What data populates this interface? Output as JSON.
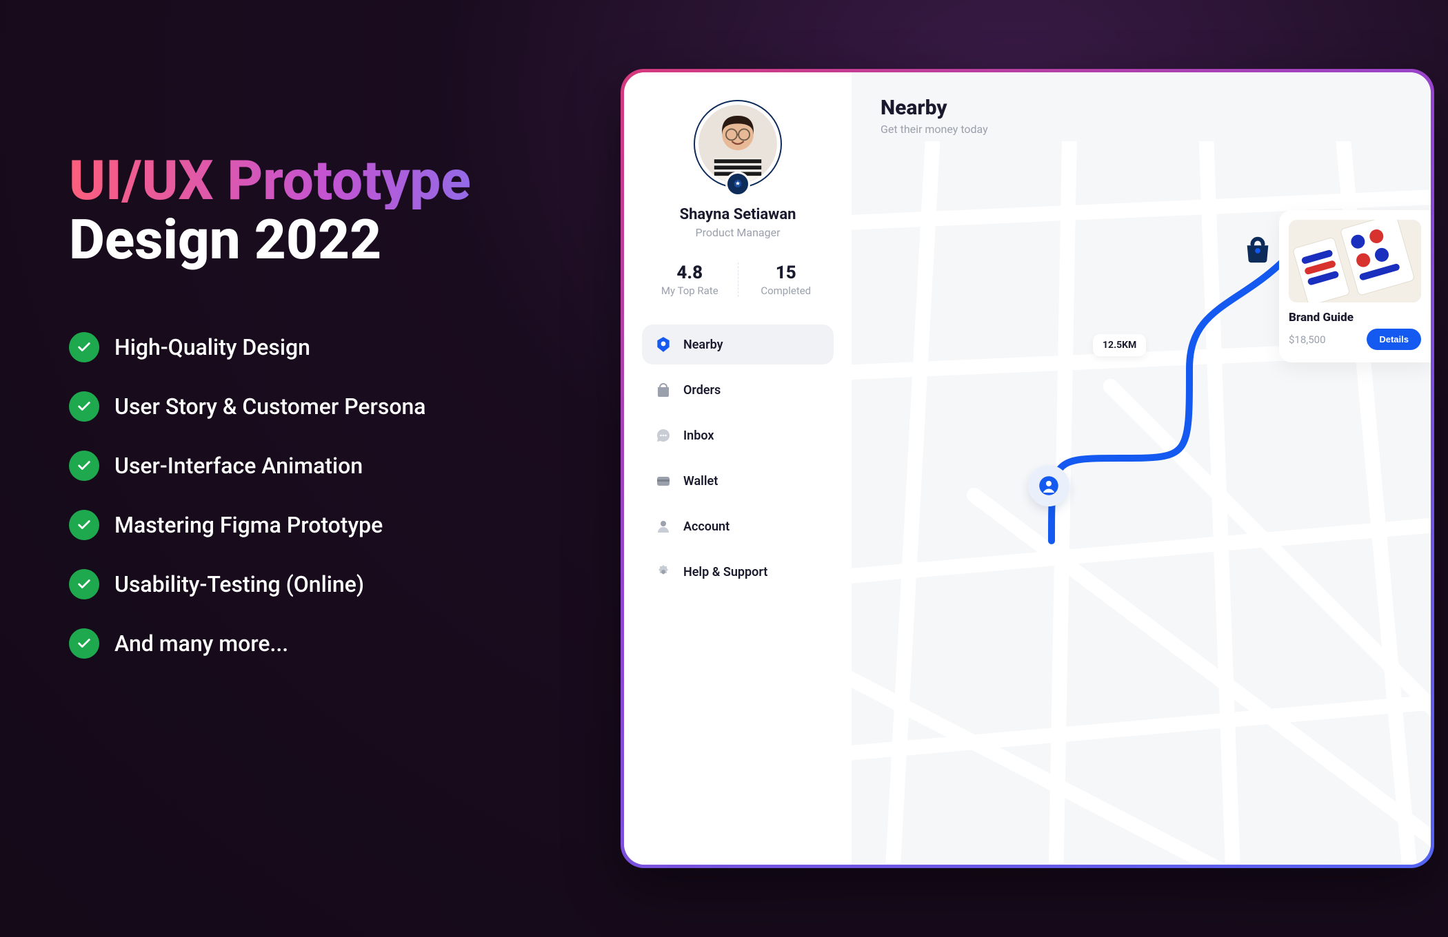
{
  "promo": {
    "title_line1": "UI/UX Prototype",
    "title_line2": "Design 2022",
    "features": [
      "High-Quality Design",
      "User Story & Customer Persona",
      "User-Interface Animation",
      "Mastering Figma Prototype",
      "Usability-Testing (Online)",
      "And many more..."
    ]
  },
  "sidebar": {
    "user_name": "Shayna Setiawan",
    "user_role": "Product Manager",
    "stats": {
      "rate_value": "4.8",
      "rate_label": "My Top Rate",
      "completed_value": "15",
      "completed_label": "Completed"
    },
    "nav": [
      {
        "label": "Nearby",
        "active": true
      },
      {
        "label": "Orders",
        "active": false
      },
      {
        "label": "Inbox",
        "active": false
      },
      {
        "label": "Wallet",
        "active": false
      },
      {
        "label": "Account",
        "active": false
      },
      {
        "label": "Help & Support",
        "active": false
      }
    ]
  },
  "main": {
    "title": "Nearby",
    "subtitle": "Get their money today",
    "distance_chip": "12.5KM",
    "card": {
      "title": "Brand Guide",
      "price": "$18,500",
      "button": "Details"
    }
  }
}
